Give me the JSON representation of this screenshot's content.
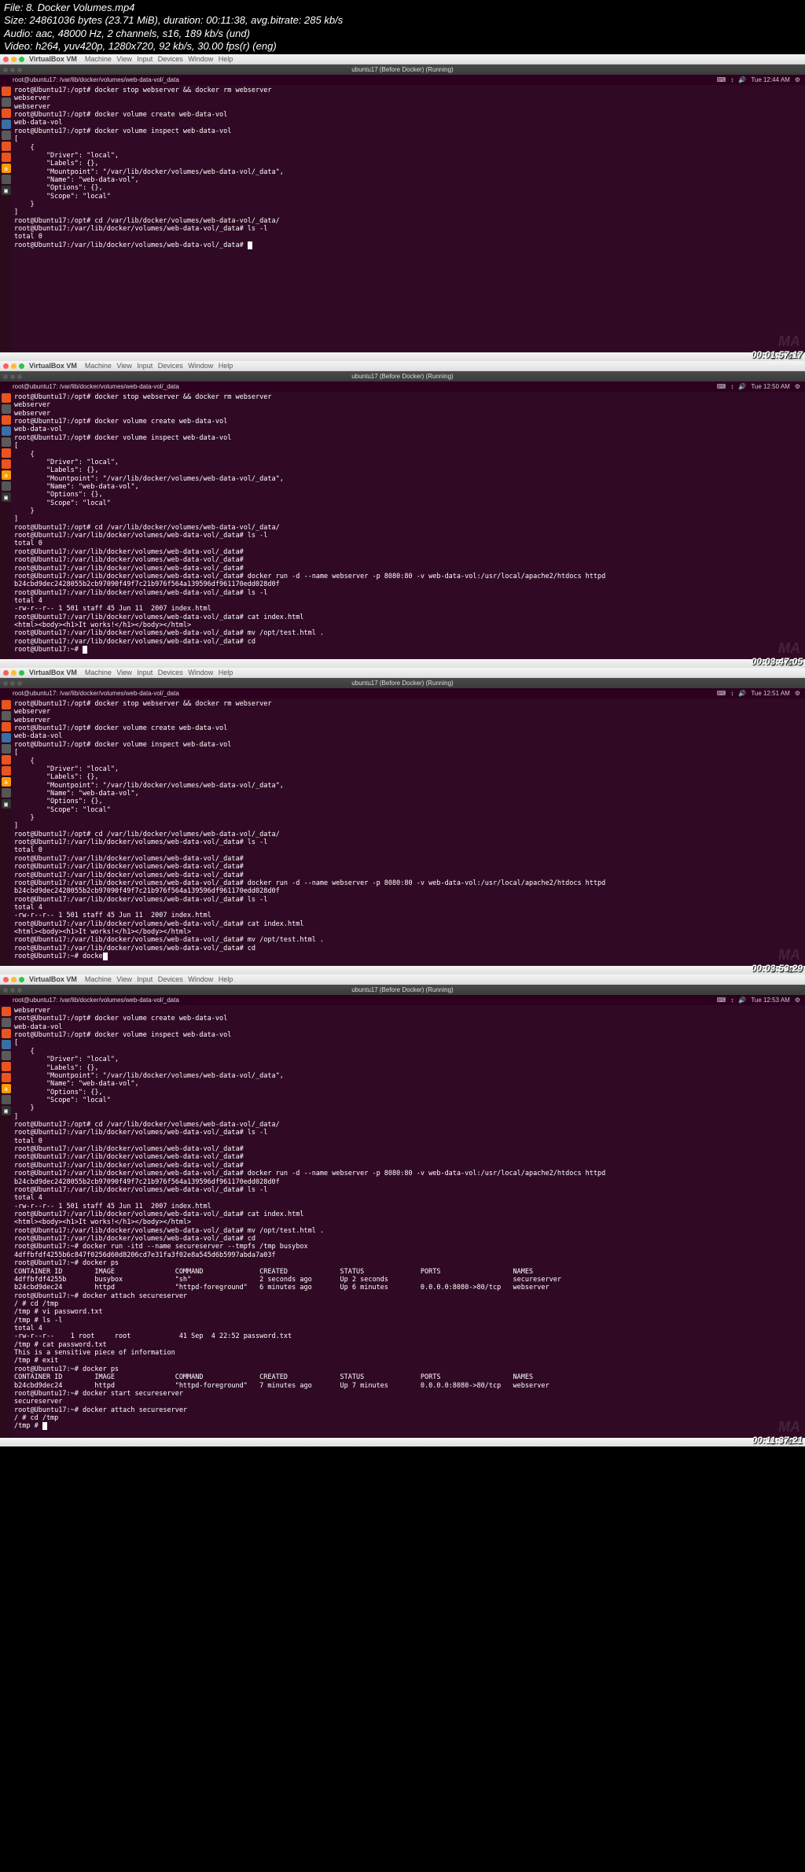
{
  "file_info": {
    "l1": "File: 8. Docker Volumes.mp4",
    "l2": "Size: 24861036 bytes (23.71 MiB), duration: 00:11:38, avg.bitrate: 285 kb/s",
    "l3": "Audio: aac, 48000 Hz, 2 channels, s16, 189 kb/s (und)",
    "l4": "Video: h264, yuv420p, 1280x720, 92 kb/s, 30.00 fps(r) (eng)"
  },
  "vb": {
    "title": "VirtualBox VM",
    "menu": "Machine  View  Input  Devices  Window  Help",
    "inner_title": "ubuntu17 (Before Docker) (Running)"
  },
  "clock": {
    "f1": "Tue 12:44 AM",
    "f2": "Tue 12:50 AM",
    "f3": "Tue 12:51 AM",
    "f4": "Tue 12:53 AM"
  },
  "tabprefix": "root@ubuntu17: /var/lib/docker/volumes/web-data-vol/_data",
  "ts": {
    "f1": "00:01:57:17",
    "f2": "00:03:47:05",
    "f3": "00:03:53:29",
    "f4": "00:11:37:21"
  },
  "wm": "MA",
  "frame1": [
    "root@Ubuntu17:/opt# docker stop webserver && docker rm webserver",
    "webserver",
    "webserver",
    "root@Ubuntu17:/opt# docker volume create web-data-vol",
    "web-data-vol",
    "root@Ubuntu17:/opt# docker volume inspect web-data-vol",
    "[",
    "    {",
    "        \"Driver\": \"local\",",
    "        \"Labels\": {},",
    "        \"Mountpoint\": \"/var/lib/docker/volumes/web-data-vol/_data\",",
    "        \"Name\": \"web-data-vol\",",
    "        \"Options\": {},",
    "        \"Scope\": \"local\"",
    "    }",
    "]",
    "root@Ubuntu17:/opt# cd /var/lib/docker/volumes/web-data-vol/_data/",
    "root@Ubuntu17:/var/lib/docker/volumes/web-data-vol/_data# ls -l",
    "total 0",
    "root@Ubuntu17:/var/lib/docker/volumes/web-data-vol/_data# "
  ],
  "frame2": [
    "root@Ubuntu17:/opt# docker stop webserver && docker rm webserver",
    "webserver",
    "webserver",
    "root@Ubuntu17:/opt# docker volume create web-data-vol",
    "web-data-vol",
    "root@Ubuntu17:/opt# docker volume inspect web-data-vol",
    "[",
    "    {",
    "        \"Driver\": \"local\",",
    "        \"Labels\": {},",
    "        \"Mountpoint\": \"/var/lib/docker/volumes/web-data-vol/_data\",",
    "        \"Name\": \"web-data-vol\",",
    "        \"Options\": {},",
    "        \"Scope\": \"local\"",
    "    }",
    "]",
    "root@Ubuntu17:/opt# cd /var/lib/docker/volumes/web-data-vol/_data/",
    "root@Ubuntu17:/var/lib/docker/volumes/web-data-vol/_data# ls -l",
    "total 0",
    "root@Ubuntu17:/var/lib/docker/volumes/web-data-vol/_data#",
    "root@Ubuntu17:/var/lib/docker/volumes/web-data-vol/_data#",
    "root@Ubuntu17:/var/lib/docker/volumes/web-data-vol/_data#",
    "root@Ubuntu17:/var/lib/docker/volumes/web-data-vol/_data# docker run -d --name webserver -p 8080:80 -v web-data-vol:/usr/local/apache2/htdocs httpd",
    "b24cbd9dec2428055b2cb97090f49f7c21b976f564a139596df961170edd028d0f",
    "root@Ubuntu17:/var/lib/docker/volumes/web-data-vol/_data# ls -l",
    "total 4",
    "-rw-r--r-- 1 501 staff 45 Jun 11  2007 index.html",
    "root@Ubuntu17:/var/lib/docker/volumes/web-data-vol/_data# cat index.html",
    "<html><body><h1>It works!</h1></body></html>",
    "root@Ubuntu17:/var/lib/docker/volumes/web-data-vol/_data# mv /opt/test.html .",
    "root@Ubuntu17:/var/lib/docker/volumes/web-data-vol/_data# cd",
    "root@Ubuntu17:~# "
  ],
  "frame3": [
    "root@Ubuntu17:/opt# docker stop webserver && docker rm webserver",
    "webserver",
    "webserver",
    "root@Ubuntu17:/opt# docker volume create web-data-vol",
    "web-data-vol",
    "root@Ubuntu17:/opt# docker volume inspect web-data-vol",
    "[",
    "    {",
    "        \"Driver\": \"local\",",
    "        \"Labels\": {},",
    "        \"Mountpoint\": \"/var/lib/docker/volumes/web-data-vol/_data\",",
    "        \"Name\": \"web-data-vol\",",
    "        \"Options\": {},",
    "        \"Scope\": \"local\"",
    "    }",
    "]",
    "root@Ubuntu17:/opt# cd /var/lib/docker/volumes/web-data-vol/_data/",
    "root@Ubuntu17:/var/lib/docker/volumes/web-data-vol/_data# ls -l",
    "total 0",
    "root@Ubuntu17:/var/lib/docker/volumes/web-data-vol/_data#",
    "root@Ubuntu17:/var/lib/docker/volumes/web-data-vol/_data#",
    "root@Ubuntu17:/var/lib/docker/volumes/web-data-vol/_data#",
    "root@Ubuntu17:/var/lib/docker/volumes/web-data-vol/_data# docker run -d --name webserver -p 8080:80 -v web-data-vol:/usr/local/apache2/htdocs httpd",
    "b24cbd9dec2428055b2cb97090f49f7c21b976f564a139596df961170edd028d0f",
    "root@Ubuntu17:/var/lib/docker/volumes/web-data-vol/_data# ls -l",
    "total 4",
    "-rw-r--r-- 1 501 staff 45 Jun 11  2007 index.html",
    "root@Ubuntu17:/var/lib/docker/volumes/web-data-vol/_data# cat index.html",
    "<html><body><h1>It works!</h1></body></html>",
    "root@Ubuntu17:/var/lib/docker/volumes/web-data-vol/_data# mv /opt/test.html .",
    "root@Ubuntu17:/var/lib/docker/volumes/web-data-vol/_data# cd",
    "root@Ubuntu17:~# docke"
  ],
  "frame4": [
    "webserver",
    "root@Ubuntu17:/opt# docker volume create web-data-vol",
    "web-data-vol",
    "root@Ubuntu17:/opt# docker volume inspect web-data-vol",
    "[",
    "    {",
    "        \"Driver\": \"local\",",
    "        \"Labels\": {},",
    "        \"Mountpoint\": \"/var/lib/docker/volumes/web-data-vol/_data\",",
    "        \"Name\": \"web-data-vol\",",
    "        \"Options\": {},",
    "        \"Scope\": \"local\"",
    "    }",
    "]",
    "root@Ubuntu17:/opt# cd /var/lib/docker/volumes/web-data-vol/_data/",
    "root@Ubuntu17:/var/lib/docker/volumes/web-data-vol/_data# ls -l",
    "total 0",
    "root@Ubuntu17:/var/lib/docker/volumes/web-data-vol/_data#",
    "root@Ubuntu17:/var/lib/docker/volumes/web-data-vol/_data#",
    "root@Ubuntu17:/var/lib/docker/volumes/web-data-vol/_data#",
    "root@Ubuntu17:/var/lib/docker/volumes/web-data-vol/_data# docker run -d --name webserver -p 8080:80 -v web-data-vol:/usr/local/apache2/htdocs httpd",
    "b24cbd9dec2428055b2cb97090f49f7c21b976f564a139596df961170edd028d0f",
    "root@Ubuntu17:/var/lib/docker/volumes/web-data-vol/_data# ls -l",
    "total 4",
    "-rw-r--r-- 1 501 staff 45 Jun 11  2007 index.html",
    "root@Ubuntu17:/var/lib/docker/volumes/web-data-vol/_data# cat index.html",
    "<html><body><h1>It works!</h1></body></html>",
    "root@Ubuntu17:/var/lib/docker/volumes/web-data-vol/_data# mv /opt/test.html .",
    "root@Ubuntu17:/var/lib/docker/volumes/web-data-vol/_data# cd",
    "root@Ubuntu17:~# docker run -itd --name secureserver --tmpfs /tmp busybox",
    "4dffbfdf4255b6c847f0256d60d8206cd7e31fa3f02e8a545d6b5997abda7a03f",
    "root@Ubuntu17:~# docker ps",
    "CONTAINER ID        IMAGE               COMMAND              CREATED             STATUS              PORTS                  NAMES",
    "4dffbfdf4255b       busybox             \"sh\"                 2 seconds ago       Up 2 seconds                               secureserver",
    "b24cbd9dec24        httpd               \"httpd-foreground\"   6 minutes ago       Up 6 minutes        0.0.0.0:8080->80/tcp   webserver",
    "root@Ubuntu17:~# docker attach secureserver",
    "/ # cd /tmp",
    "/tmp # vi password.txt",
    "/tmp # ls -l",
    "total 4",
    "-rw-r--r--    1 root     root            41 Sep  4 22:52 password.txt",
    "/tmp # cat password.txt",
    "This is a sensitive piece of information",
    "/tmp # exit",
    "root@Ubuntu17:~# docker ps",
    "CONTAINER ID        IMAGE               COMMAND              CREATED             STATUS              PORTS                  NAMES",
    "b24cbd9dec24        httpd               \"httpd-foreground\"   7 minutes ago       Up 7 minutes        0.0.0.0:8080->80/tcp   webserver",
    "root@Ubuntu17:~# docker start secureserver",
    "secureserver",
    "root@Ubuntu17:~# docker attach secureserver",
    "/ # cd /tmp",
    "/tmp # "
  ]
}
